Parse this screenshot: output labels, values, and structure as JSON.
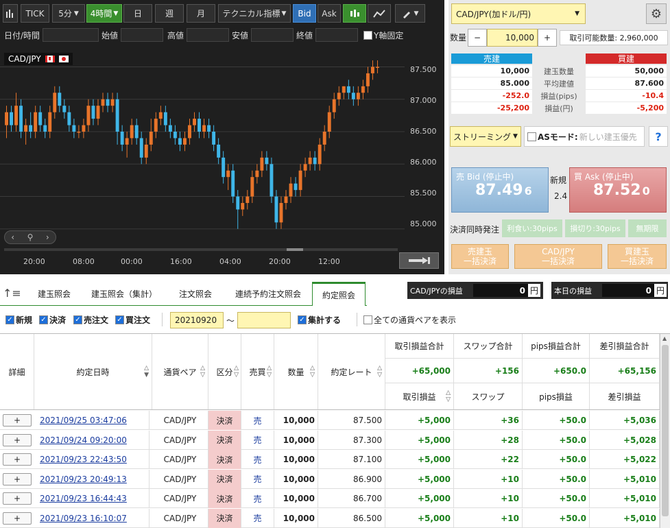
{
  "toolbar": {
    "tick": "TICK",
    "interval": "5分",
    "period": "4時間",
    "day": "日",
    "week": "週",
    "month": "月",
    "technical": "テクニカル指標",
    "bid": "Bid",
    "ask": "Ask"
  },
  "ohlc": {
    "datetime_label": "日付/時間",
    "open_label": "始値",
    "high_label": "高値",
    "low_label": "安値",
    "close_label": "終値",
    "yaxis_fix": "Y軸固定"
  },
  "chart": {
    "symbol": "CAD/JPY",
    "y_ticks": [
      "87.500",
      "87.000",
      "86.500",
      "86.000",
      "85.500",
      "85.000"
    ],
    "x_ticks": [
      "20:00",
      "08:00",
      "00:00",
      "16:00",
      "04:00",
      "20:00",
      "12:00"
    ]
  },
  "chart_data": {
    "type": "candlestick",
    "ylim": [
      84.85,
      87.6
    ],
    "candles": [
      [
        86.6,
        86.9,
        86.4,
        86.8
      ],
      [
        86.8,
        86.9,
        86.5,
        86.6
      ],
      [
        86.6,
        87.1,
        86.5,
        86.9
      ],
      [
        86.9,
        87.0,
        86.4,
        86.5
      ],
      [
        86.5,
        86.7,
        86.3,
        86.6
      ],
      [
        86.6,
        86.8,
        86.4,
        86.5
      ],
      [
        86.5,
        86.9,
        86.4,
        86.8
      ],
      [
        86.8,
        86.9,
        86.5,
        86.6
      ],
      [
        86.6,
        86.7,
        86.4,
        86.5
      ],
      [
        86.5,
        86.9,
        86.4,
        86.8
      ],
      [
        86.8,
        87.2,
        86.7,
        87.1
      ],
      [
        87.1,
        87.2,
        86.8,
        86.9
      ],
      [
        86.9,
        87.0,
        86.7,
        86.8
      ],
      [
        86.8,
        86.9,
        86.5,
        86.6
      ],
      [
        86.6,
        86.7,
        86.4,
        86.5
      ],
      [
        86.5,
        86.6,
        86.4,
        86.5
      ],
      [
        86.5,
        86.7,
        86.4,
        86.6
      ],
      [
        86.6,
        87.0,
        86.5,
        86.9
      ],
      [
        86.9,
        87.0,
        86.6,
        86.7
      ],
      [
        86.7,
        87.0,
        86.6,
        86.9
      ],
      [
        86.9,
        87.1,
        86.8,
        87.0
      ],
      [
        87.0,
        87.1,
        86.8,
        86.9
      ],
      [
        86.9,
        87.1,
        86.8,
        87.0
      ],
      [
        87.0,
        87.1,
        86.3,
        86.5
      ],
      [
        86.5,
        86.6,
        86.2,
        86.3
      ],
      [
        86.3,
        86.5,
        86.1,
        86.4
      ],
      [
        86.4,
        86.7,
        86.3,
        86.6
      ],
      [
        86.6,
        86.7,
        86.3,
        86.4
      ],
      [
        86.4,
        86.5,
        86.0,
        86.1
      ],
      [
        86.1,
        86.4,
        86.0,
        86.3
      ],
      [
        86.3,
        86.7,
        86.2,
        86.5
      ],
      [
        86.5,
        86.8,
        86.4,
        86.7
      ],
      [
        86.7,
        86.9,
        86.6,
        86.8
      ],
      [
        86.8,
        86.9,
        86.5,
        86.6
      ],
      [
        86.6,
        86.7,
        86.4,
        86.5
      ],
      [
        86.5,
        86.6,
        86.3,
        86.4
      ],
      [
        86.4,
        86.5,
        86.2,
        86.3
      ],
      [
        86.3,
        86.5,
        86.2,
        86.4
      ],
      [
        86.4,
        86.7,
        86.3,
        86.6
      ],
      [
        86.6,
        86.8,
        86.5,
        86.7
      ],
      [
        86.7,
        86.8,
        86.4,
        86.5
      ],
      [
        86.5,
        86.7,
        86.4,
        86.6
      ],
      [
        86.6,
        86.7,
        86.4,
        86.5
      ],
      [
        86.5,
        86.6,
        86.2,
        86.3
      ],
      [
        86.3,
        86.4,
        86.0,
        86.1
      ],
      [
        86.1,
        86.2,
        85.7,
        85.8
      ],
      [
        85.8,
        86.0,
        85.6,
        85.9
      ],
      [
        85.9,
        86.0,
        85.4,
        85.5
      ],
      [
        85.5,
        85.6,
        85.0,
        85.3
      ],
      [
        85.3,
        85.5,
        85.2,
        85.4
      ],
      [
        85.4,
        85.6,
        85.3,
        85.5
      ],
      [
        85.5,
        85.9,
        85.4,
        85.8
      ],
      [
        85.8,
        86.0,
        85.7,
        85.9
      ],
      [
        85.9,
        86.2,
        85.8,
        86.1
      ],
      [
        86.1,
        86.2,
        85.9,
        86.0
      ],
      [
        86.0,
        86.1,
        85.4,
        85.5
      ],
      [
        85.5,
        85.6,
        85.0,
        85.1
      ],
      [
        85.1,
        85.5,
        85.0,
        85.4
      ],
      [
        85.4,
        85.6,
        85.3,
        85.5
      ],
      [
        85.5,
        85.8,
        85.4,
        85.7
      ],
      [
        85.7,
        85.8,
        85.5,
        85.6
      ],
      [
        85.6,
        86.0,
        85.5,
        85.9
      ],
      [
        85.9,
        86.1,
        85.8,
        86.0
      ],
      [
        86.0,
        86.2,
        85.9,
        86.1
      ],
      [
        86.1,
        86.2,
        85.9,
        86.0
      ],
      [
        86.0,
        86.4,
        85.9,
        86.3
      ],
      [
        86.3,
        86.6,
        86.2,
        86.5
      ],
      [
        86.5,
        86.9,
        86.4,
        86.8
      ],
      [
        86.8,
        87.1,
        86.7,
        87.0
      ],
      [
        87.0,
        87.2,
        86.9,
        87.1
      ],
      [
        87.1,
        87.2,
        87.0,
        87.2
      ],
      [
        87.2,
        87.3,
        87.0,
        87.1
      ],
      [
        87.1,
        87.2,
        86.9,
        87.0
      ],
      [
        87.0,
        87.2,
        86.9,
        87.1
      ],
      [
        87.1,
        87.3,
        87.0,
        87.2
      ],
      [
        87.2,
        87.5,
        87.1,
        87.4
      ],
      [
        87.4,
        87.6,
        87.3,
        87.5
      ],
      [
        87.5,
        87.6,
        87.4,
        87.5
      ]
    ]
  },
  "rp": {
    "pair_select": "CAD/JPY(加ドル/円)",
    "qty_label": "数量",
    "minus": "−",
    "qty_value": "10,000",
    "plus": "+",
    "avail": "取引可能数量: 2,960,000",
    "sell_head": "売建",
    "buy_head": "買建",
    "rows": [
      {
        "label": "建玉数量",
        "sell": "10,000",
        "buy": "50,000"
      },
      {
        "label": "平均建値",
        "sell": "85.000",
        "buy": "87.600"
      },
      {
        "label": "損益(pips)",
        "sell": "-252.0",
        "buy": "-10.4"
      },
      {
        "label": "損益(円)",
        "sell": "-25,200",
        "buy": "-5,200"
      }
    ],
    "streaming": "ストリーミング",
    "as_mode": "ASモード:",
    "as_mode_value": "新しい建玉優先",
    "help": "?",
    "bid_label": "売 Bid (停止中)",
    "bid_big": "87.49",
    "bid_small": "6",
    "new_label": "新規",
    "spread": "2.4",
    "ask_label": "買 Ask (停止中)",
    "ask_big": "87.52",
    "ask_small": "0",
    "settle_label": "決済同時発注",
    "tp": "利食い:30pips",
    "sl": "損切り:30pips",
    "nolimit": "無期限",
    "sell_close_1": "売建玉",
    "sell_close_2": "一括決済",
    "pair_close_1": "CAD/JPY",
    "pair_close_2": "一括決済",
    "buy_close_1": "買建玉",
    "buy_close_2": "一括決済"
  },
  "tabs": [
    "建玉照会",
    "建玉照会（集計）",
    "注文照会",
    "連続予約注文照会",
    "約定照会"
  ],
  "pnl": {
    "pair_label": "CAD/JPYの損益",
    "pair_value": "0",
    "unit": "円",
    "today_label": "本日の損益",
    "today_value": "0"
  },
  "filters": {
    "new": "新規",
    "settle": "決済",
    "sell_order": "売注文",
    "buy_order": "買注文",
    "date_from": "20210920",
    "tilde": "〜",
    "aggregate": "集計する",
    "all_pairs": "全ての通貨ペアを表示"
  },
  "table": {
    "h_detail": "詳細",
    "h_date": "約定日時",
    "h_pair": "通貨ペア",
    "h_type": "区分",
    "h_side": "売買",
    "h_qty": "数量",
    "h_rate": "約定レート",
    "h_tpl_total": "取引損益合計",
    "h_swap_total": "スワップ合計",
    "h_pips_total": "pips損益合計",
    "h_net_total": "差引損益合計",
    "tot_tpl": "+65,000",
    "tot_swap": "+156",
    "tot_pips": "+650.0",
    "tot_net": "+65,156",
    "h_tpl": "取引損益",
    "h_swap": "スワップ",
    "h_pips": "pips損益",
    "h_net": "差引損益",
    "rows": [
      {
        "btn": "+",
        "date": "2021/09/25 03:47:06",
        "pair": "CAD/JPY",
        "type": "決済",
        "side": "売",
        "qty": "10,000",
        "rate": "87.500",
        "tpl": "+5,000",
        "swap": "+36",
        "pips": "+50.0",
        "net": "+5,036"
      },
      {
        "btn": "+",
        "date": "2021/09/24 09:20:00",
        "pair": "CAD/JPY",
        "type": "決済",
        "side": "売",
        "qty": "10,000",
        "rate": "87.300",
        "tpl": "+5,000",
        "swap": "+28",
        "pips": "+50.0",
        "net": "+5,028"
      },
      {
        "btn": "+",
        "date": "2021/09/23 22:43:50",
        "pair": "CAD/JPY",
        "type": "決済",
        "side": "売",
        "qty": "10,000",
        "rate": "87.100",
        "tpl": "+5,000",
        "swap": "+22",
        "pips": "+50.0",
        "net": "+5,022"
      },
      {
        "btn": "+",
        "date": "2021/09/23 20:49:13",
        "pair": "CAD/JPY",
        "type": "決済",
        "side": "売",
        "qty": "10,000",
        "rate": "86.900",
        "tpl": "+5,000",
        "swap": "+10",
        "pips": "+50.0",
        "net": "+5,010"
      },
      {
        "btn": "+",
        "date": "2021/09/23 16:44:43",
        "pair": "CAD/JPY",
        "type": "決済",
        "side": "売",
        "qty": "10,000",
        "rate": "86.700",
        "tpl": "+5,000",
        "swap": "+10",
        "pips": "+50.0",
        "net": "+5,010"
      },
      {
        "btn": "+",
        "date": "2021/09/23 16:10:07",
        "pair": "CAD/JPY",
        "type": "決済",
        "side": "売",
        "qty": "10,000",
        "rate": "86.500",
        "tpl": "+5,000",
        "swap": "+10",
        "pips": "+50.0",
        "net": "+5,010"
      }
    ]
  }
}
